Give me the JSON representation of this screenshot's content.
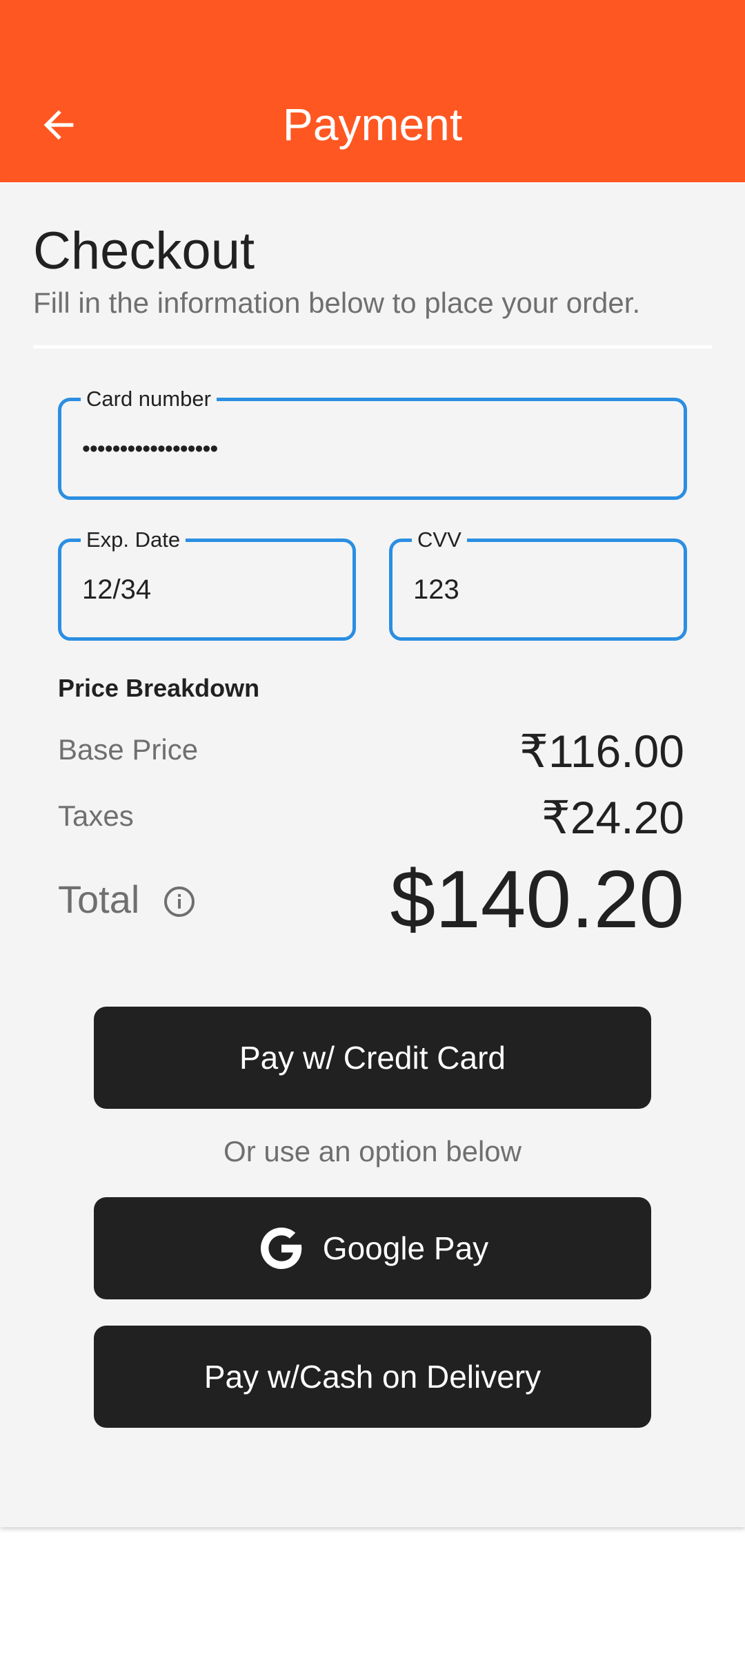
{
  "app_bar": {
    "title": "Payment",
    "back_icon": "arrow-left-icon",
    "color": "#ff5722"
  },
  "checkout": {
    "title": "Checkout",
    "subtitle": "Fill in the information below to place your order."
  },
  "form": {
    "card_number": {
      "label": "Card number",
      "value": "••••••••••••••••••"
    },
    "exp_date": {
      "label": "Exp. Date",
      "value": "12/34"
    },
    "cvv": {
      "label": "CVV",
      "value": "123"
    },
    "border_color": "#2b8ee2"
  },
  "price_breakdown": {
    "title": "Price Breakdown",
    "base_price_label": "Base Price",
    "base_price_value": "₹116.00",
    "taxes_label": "Taxes",
    "taxes_value": "₹24.20",
    "total_label": "Total",
    "total_value": "$140.20",
    "info_icon": "info-icon"
  },
  "actions": {
    "credit_card_label": "Pay w/ Credit Card",
    "or_text": "Or use an option below",
    "google_pay_label": "Google Pay",
    "google_icon": "google-g-icon",
    "cash_label": "Pay w/Cash on Delivery",
    "button_color": "#212121"
  }
}
